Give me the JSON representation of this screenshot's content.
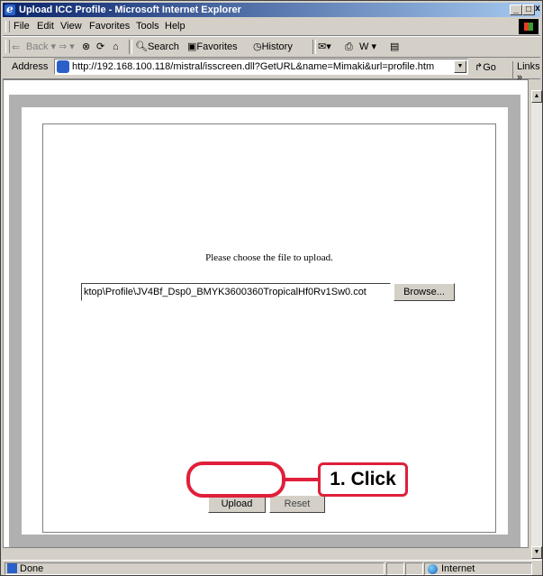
{
  "window": {
    "title": "Upload ICC Profile - Microsoft Internet Explorer"
  },
  "menu": [
    "File",
    "Edit",
    "View",
    "Favorites",
    "Tools",
    "Help"
  ],
  "toolbar": {
    "back": "Back",
    "search": "Search",
    "favorites": "Favorites",
    "history": "History"
  },
  "address": {
    "label": "Address",
    "url": "http://192.168.100.118/mistral/isscreen.dll?GetURL&name=Mimaki&url=profile.htm",
    "go": "Go",
    "links": "Links"
  },
  "page": {
    "prompt": "Please choose the file to upload.",
    "file_value": "ktop\\Profile\\JV4Bf_Dsp0_BMYK3600360TropicalHf0Rv1Sw0.cot",
    "browse": "Browse...",
    "upload": "Upload",
    "reset": "Reset"
  },
  "annotation": {
    "label": "1. Click",
    "color": "#e01f3a"
  },
  "status": {
    "text": "Done",
    "zone": "Internet"
  }
}
